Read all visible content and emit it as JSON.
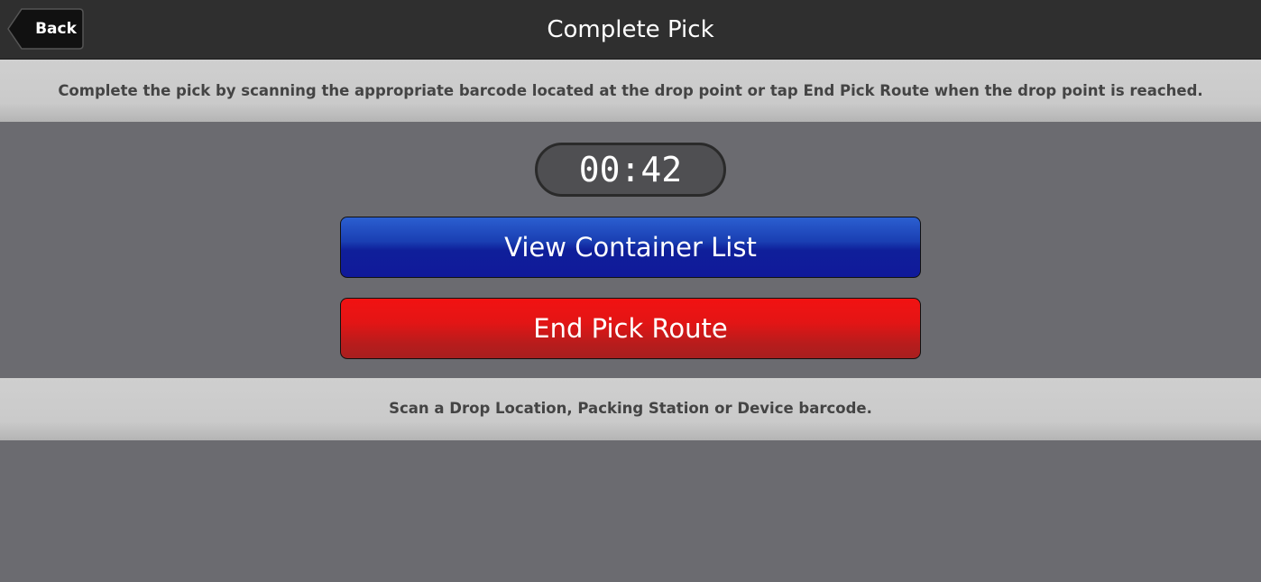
{
  "header": {
    "back_label": "Back",
    "title": "Complete Pick"
  },
  "instructions": {
    "top": "Complete the pick by scanning the appropriate barcode located at the drop point or tap End Pick Route when the drop point is reached.",
    "bottom": "Scan a Drop Location, Packing Station or Device barcode."
  },
  "timer": {
    "value": "00:42"
  },
  "actions": {
    "view_container_list": "View Container List",
    "end_pick_route": "End Pick Route"
  },
  "colors": {
    "header_bg": "#2f2f2f",
    "body_bg": "#6b6b70",
    "primary_button": "#10199a",
    "danger_button": "#e31515"
  }
}
